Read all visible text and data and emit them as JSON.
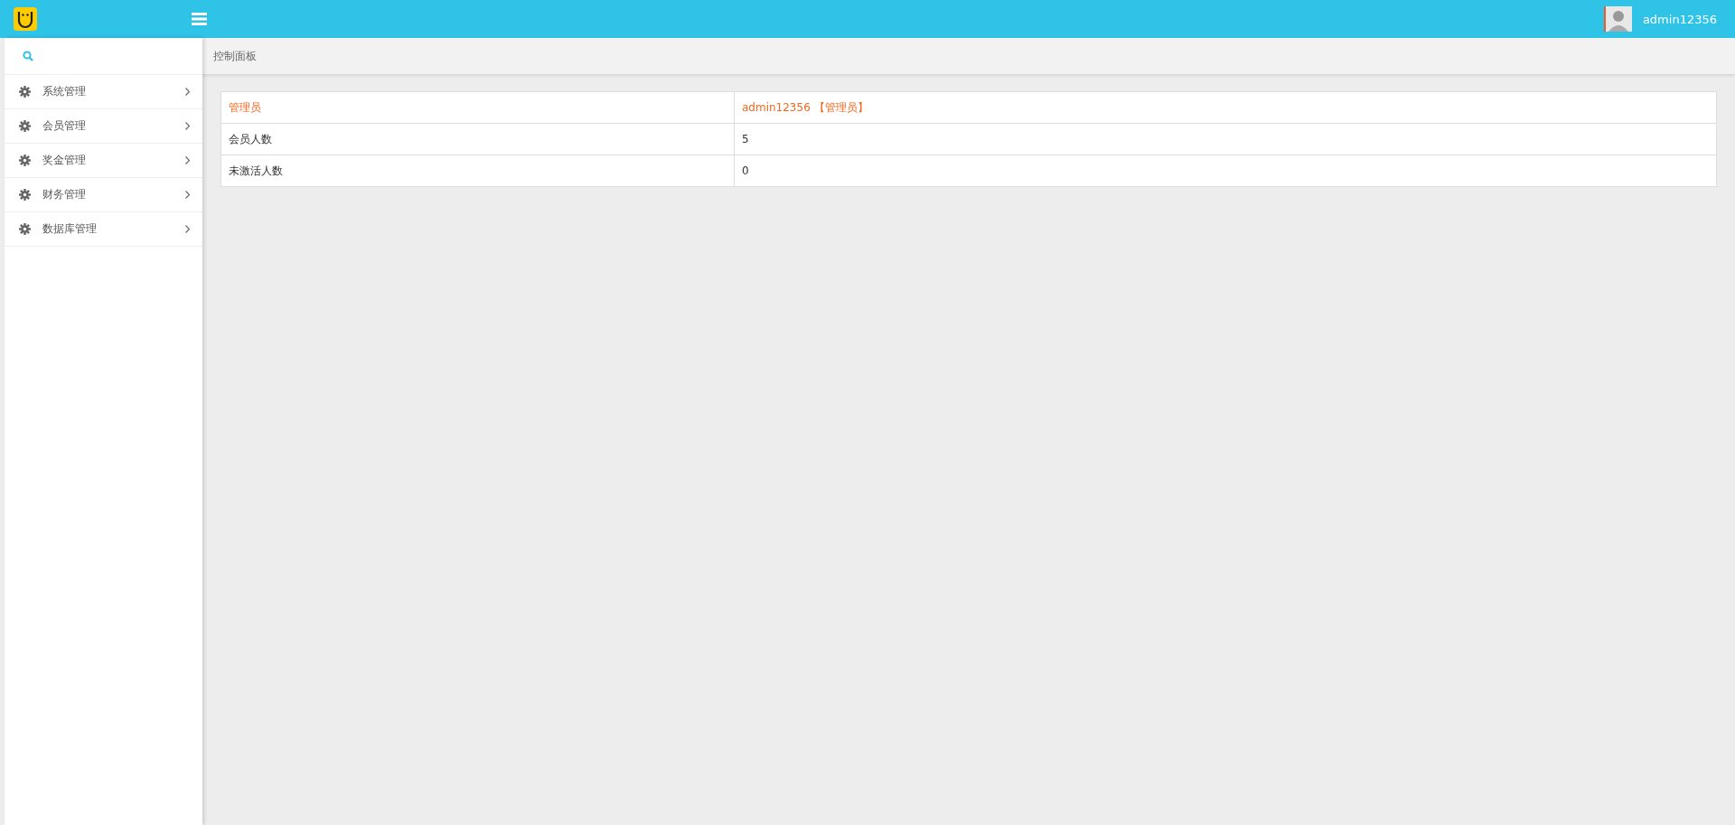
{
  "header": {
    "user": "admin12356"
  },
  "sidebar": {
    "items": [
      {
        "label": "系统管理"
      },
      {
        "label": "会员管理"
      },
      {
        "label": "奖金管理"
      },
      {
        "label": "财务管理"
      },
      {
        "label": "数据库管理"
      }
    ]
  },
  "breadcrumb": "控制面板",
  "table": {
    "rows": [
      {
        "label": "管理员",
        "value": "admin12356 【管理员】",
        "highlighted": true
      },
      {
        "label": "会员人数",
        "value": "5",
        "highlighted": false
      },
      {
        "label": "未激活人数",
        "value": "0",
        "highlighted": false
      }
    ]
  }
}
